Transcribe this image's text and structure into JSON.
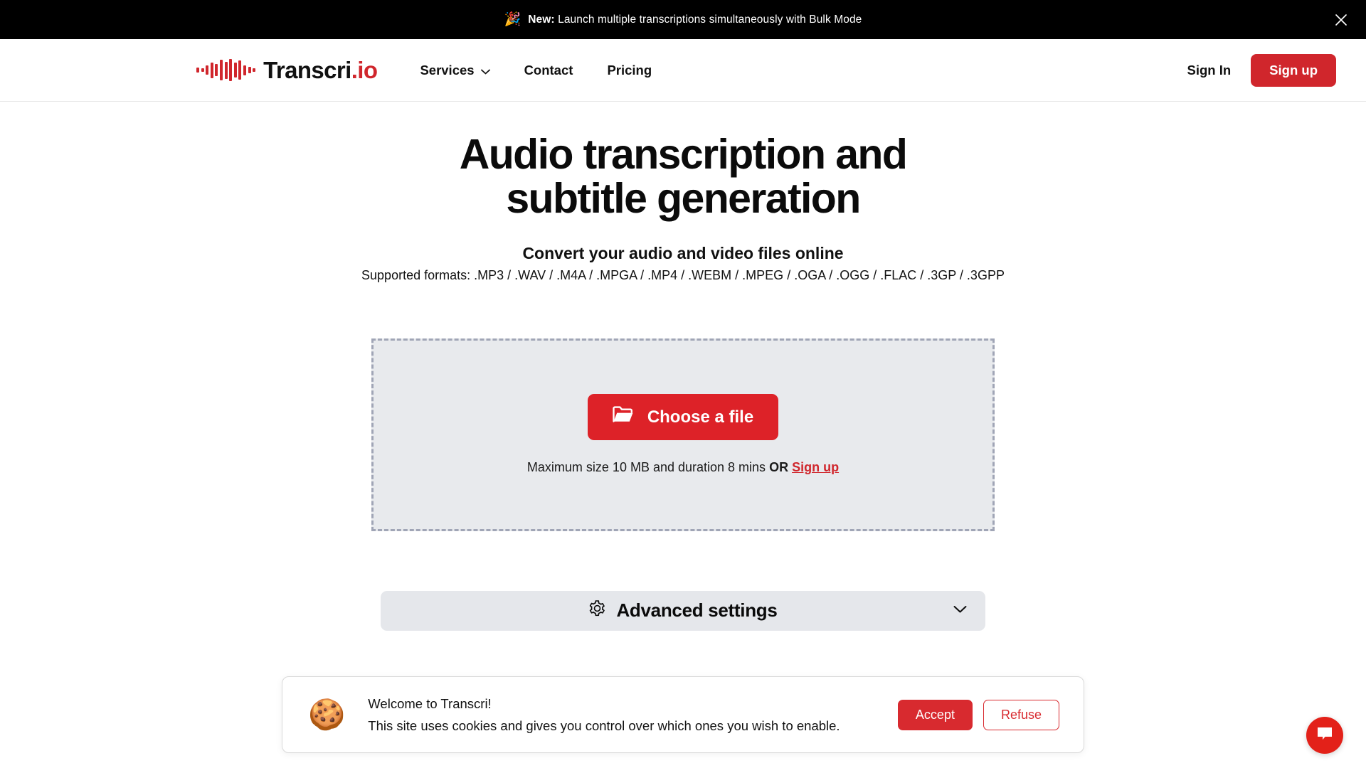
{
  "announcement": {
    "emoji": "🎉",
    "label": "New:",
    "text": " Launch multiple transcriptions simultaneously with Bulk Mode",
    "close_icon": "close-icon"
  },
  "header": {
    "logo_name": "Transcri",
    "logo_suffix": ".io",
    "nav": [
      {
        "label": "Services",
        "has_chevron": true
      },
      {
        "label": "Contact",
        "has_chevron": false
      },
      {
        "label": "Pricing",
        "has_chevron": false
      }
    ],
    "sign_in_label": "Sign In",
    "sign_up_label": "Sign up"
  },
  "hero": {
    "title": "Audio transcription and subtitle generation",
    "subtitle": "Convert your audio and video files online",
    "formats": "Supported formats: .MP3 / .WAV / .M4A / .MPGA / .MP4 / .WEBM / .MPEG / .OGA / .OGG / .FLAC / .3GP / .3GPP"
  },
  "dropzone": {
    "choose_file_label": "Choose a file",
    "note_main": "Maximum size 10 MB and duration 8 mins ",
    "note_or": "OR",
    "note_link": "Sign up"
  },
  "advanced": {
    "label": "Advanced settings",
    "gear_icon": "gear-icon",
    "chevron_icon": "chevron-down-icon"
  },
  "cookie": {
    "emoji": "🍪",
    "title": "Welcome to Transcri!",
    "description": "This site uses cookies and gives you control over which ones you wish to enable.",
    "accept_label": "Accept",
    "refuse_label": "Refuse"
  },
  "chat": {
    "icon": "chat-bubble-icon"
  },
  "colors": {
    "brand_red": "#d0262c",
    "button_red": "#dd2228",
    "banner_black": "#000000",
    "dropzone_bg": "#e8eaed",
    "dropzone_border": "#a0a5b6",
    "advanced_bg": "#e5e7eb"
  }
}
